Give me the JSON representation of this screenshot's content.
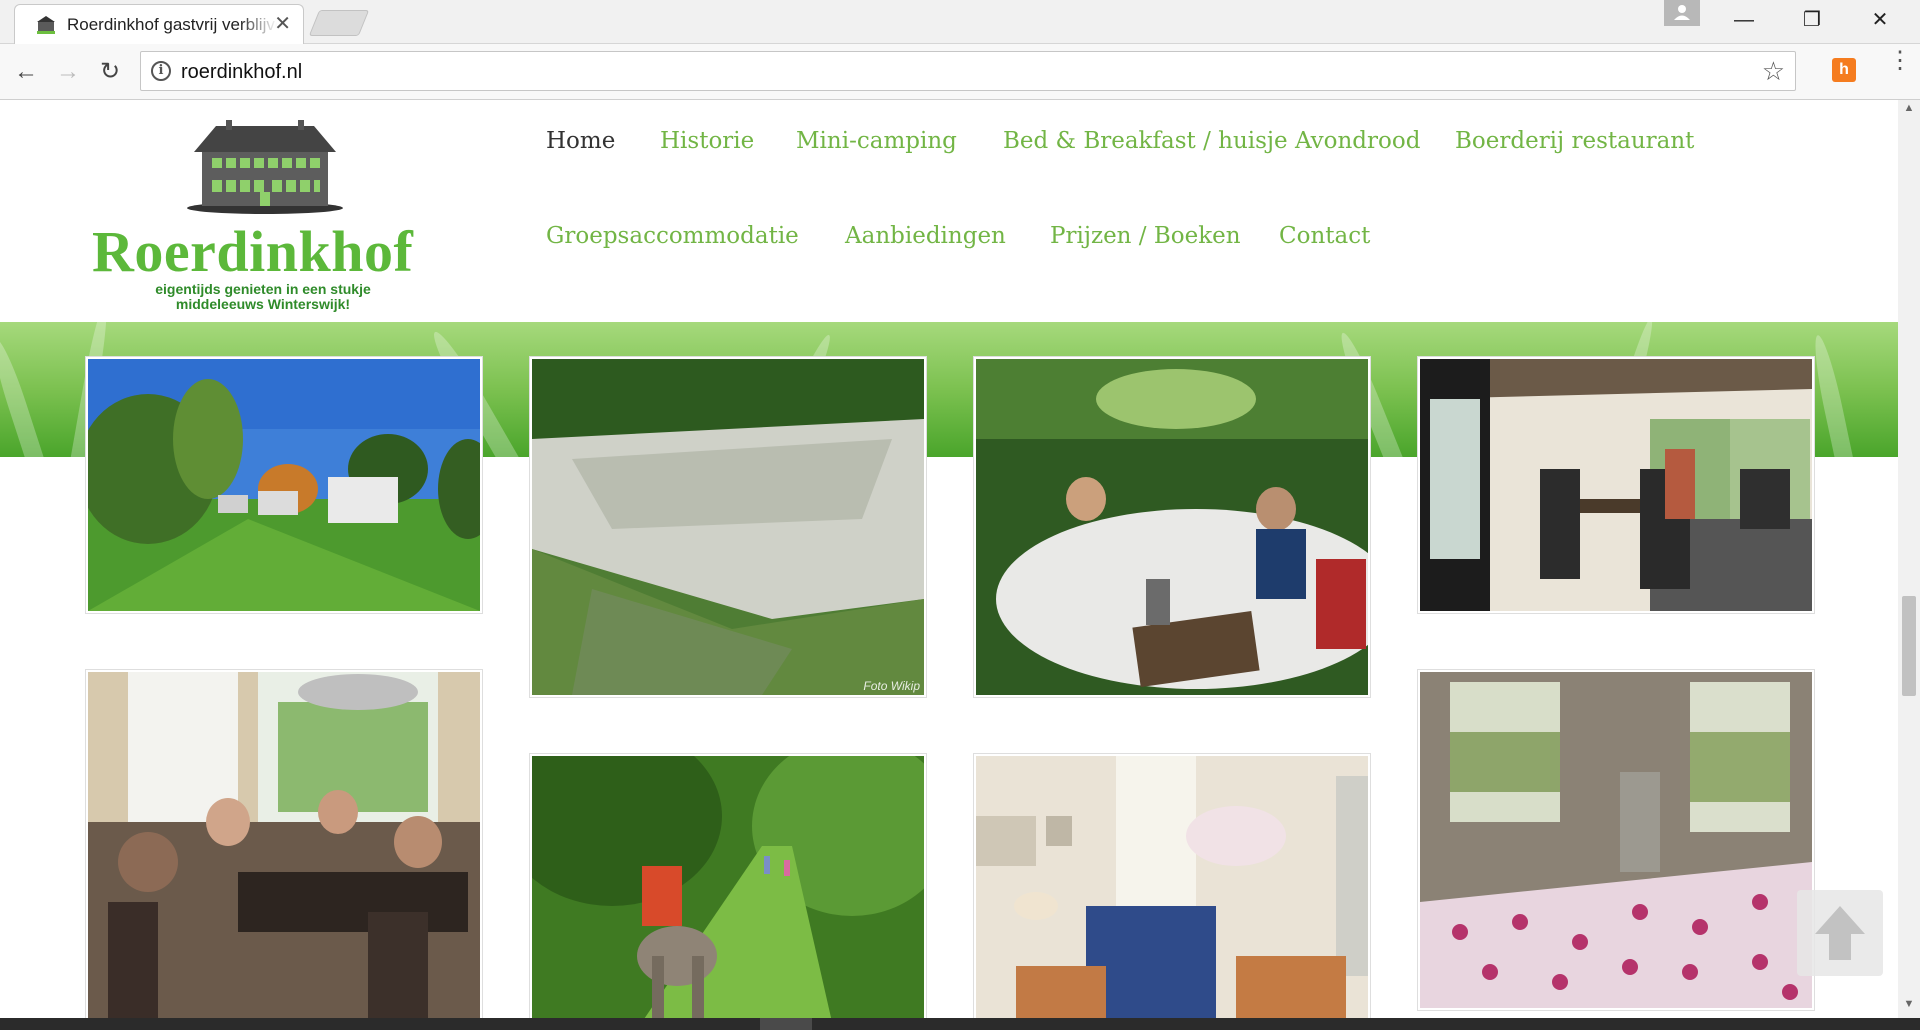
{
  "browser": {
    "tab_title": "Roerdinkhof gastvrij verblijven",
    "url": "roerdinkhof.nl"
  },
  "site": {
    "brand": "Roerdinkhof",
    "tagline_line1": "eigentijds genieten in een stukje",
    "tagline_line2": "middeleeuws Winterswijk!",
    "accent_color": "#72b545",
    "nav": [
      {
        "label": "Home",
        "active": true
      },
      {
        "label": "Historie"
      },
      {
        "label": "Mini-camping"
      },
      {
        "label": "Bed & Breakfast / huisje Avondrood"
      },
      {
        "label": "Boerderij restaurant"
      },
      {
        "label": "Groepsaccommodatie"
      },
      {
        "label": "Aanbiedingen"
      },
      {
        "label": "Prijzen / Boeken"
      },
      {
        "label": "Contact"
      }
    ]
  },
  "gallery": {
    "photo_credit": "Foto Wikip"
  },
  "icons": {
    "back": "arrow-left-icon",
    "forward": "arrow-right-icon",
    "reload": "reload-icon",
    "info": "info-icon",
    "bookmark": "star-icon",
    "scroll_top": "arrow-up-icon"
  }
}
